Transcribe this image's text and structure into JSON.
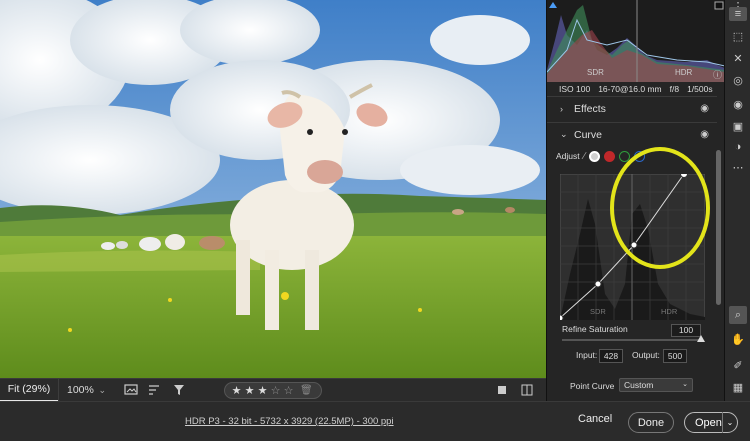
{
  "viewbar": {
    "fit_label": "Fit (29%)",
    "zoom_label": "100%",
    "zoom_caret": "⌄",
    "rating": {
      "stars": [
        "★",
        "★",
        "★",
        "☆",
        "☆"
      ],
      "filled": 3,
      "max": 5,
      "trash_icon": "🗑"
    }
  },
  "statusbar": {
    "file_info": "HDR P3 - 32 bit - 5732 x 3929 (22.5MP) - 300 ppi",
    "cancel_label": "Cancel",
    "done_label": "Done",
    "open_label": "Open",
    "open_caret": "⌄"
  },
  "histogram": {
    "sdr_label": "SDR",
    "hdr_label": "HDR",
    "info_icon": "ⓘ"
  },
  "exif": {
    "iso": "ISO 100",
    "lens": "16-70@16.0 mm",
    "aperture": "f/8",
    "shutter": "1/500s"
  },
  "sections": {
    "effects_label": "Effects",
    "curve_label": "Curve"
  },
  "curve": {
    "adjust_label": "Adjust",
    "sdr_label": "SDR",
    "hdr_label": "HDR",
    "channel_colors": [
      "#d0d0d0",
      "#c0282a",
      "#2f9c3c",
      "#2c68c8"
    ],
    "refine_label": "Refine Saturation",
    "refine_value": "100",
    "input_label": "Input:",
    "input_value": "428",
    "output_label": "Output:",
    "output_value": "500",
    "point_curve_label": "Point Curve",
    "point_curve_value": "Custom"
  },
  "colors": {
    "highlight_ring": "#e3e41a",
    "panel_bg": "#252525",
    "accent": "#4b9cf5"
  }
}
